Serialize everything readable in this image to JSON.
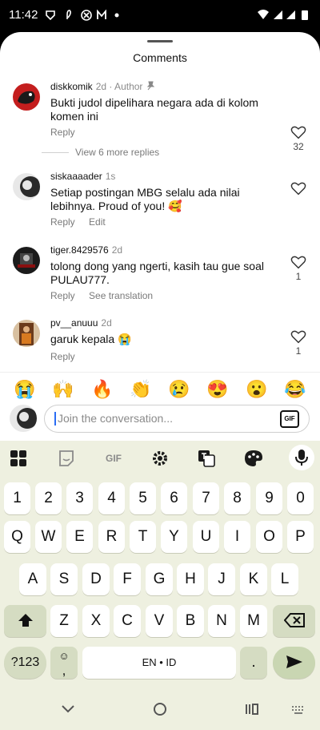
{
  "status_bar": {
    "time": "11:42",
    "left_icons": [
      "shield-icon",
      "feather-icon",
      "compass-icon",
      "mail-icon",
      "dot-icon"
    ],
    "right_icons": [
      "wifi-icon",
      "signal-icon",
      "signal-icon",
      "battery-icon"
    ]
  },
  "sheet": {
    "title": "Comments"
  },
  "comments": [
    {
      "username": "diskkomik",
      "time": "2d",
      "badge": "· Author",
      "pinned": true,
      "text": "Bukti judol dipelihara negara ada di kolom komen ini",
      "actions": [
        "Reply"
      ],
      "likes": "32"
    },
    {
      "username": "siskaaaader",
      "time": "1s",
      "text": "Setiap postingan MBG selalu ada nilai lebihnya. Proud of you! 🥰",
      "actions": [
        "Reply",
        "Edit"
      ],
      "likes": ""
    },
    {
      "username": "tiger.8429576",
      "time": "2d",
      "text": "tolong dong yang ngerti, kasih tau gue soal PULAU777.",
      "actions": [
        "Reply",
        "See translation"
      ],
      "likes": "1"
    },
    {
      "username": "pv__anuuu",
      "time": "2d",
      "text": "garuk kepala 😭",
      "actions": [
        "Reply"
      ],
      "likes": "1"
    }
  ],
  "more_replies": "View 6 more replies",
  "quick_emojis": [
    "😭",
    "🙌",
    "🔥",
    "👏",
    "😢",
    "😍",
    "😮",
    "😂"
  ],
  "input": {
    "placeholder": "Join the conversation...",
    "gif_label": "GIF"
  },
  "keyboard": {
    "toolbar": [
      "apps-icon",
      "sticker-icon",
      "gif-icon",
      "gear-icon",
      "translate-icon",
      "palette-icon",
      "mic-icon"
    ],
    "toolbar_gif_label": "GIF",
    "row_numbers": [
      "1",
      "2",
      "3",
      "4",
      "5",
      "6",
      "7",
      "8",
      "9",
      "0"
    ],
    "row1": [
      "Q",
      "W",
      "E",
      "R",
      "T",
      "Y",
      "U",
      "I",
      "O",
      "P"
    ],
    "row2": [
      "A",
      "S",
      "D",
      "F",
      "G",
      "H",
      "J",
      "K",
      "L"
    ],
    "row3": [
      "Z",
      "X",
      "C",
      "V",
      "B",
      "N",
      "M"
    ],
    "symbols_label": "?123",
    "comma_label": ",",
    "space_label": "EN • ID",
    "period_label": "."
  },
  "nav_bar": [
    "back-icon",
    "home-icon",
    "recents-icon",
    "keyboard-switch-icon"
  ]
}
